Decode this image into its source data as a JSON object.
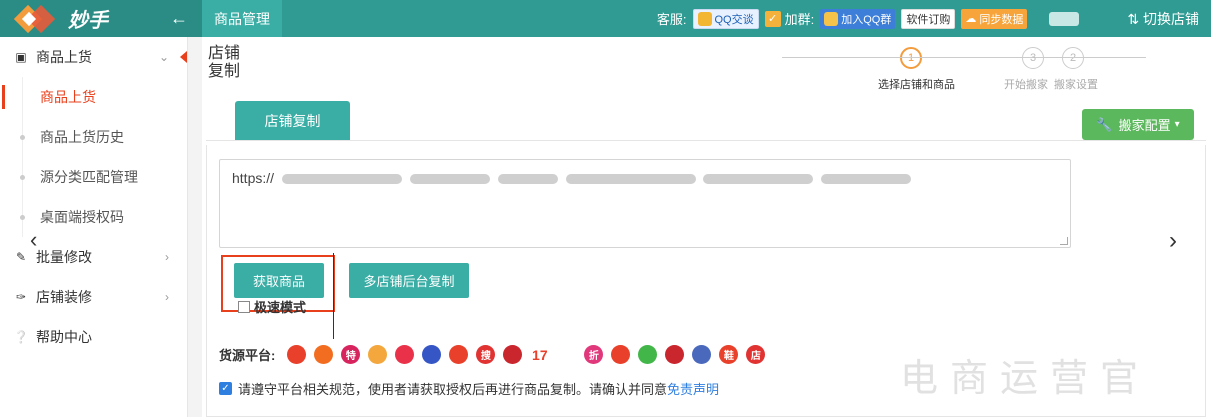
{
  "brand": {
    "name": "妙手"
  },
  "top": {
    "title": "商品管理",
    "service_label": "客服:",
    "qq_chat": "QQ交谈",
    "join_group_label": "加群:",
    "join_qq_group": "加入QQ群",
    "software_order": "软件订购",
    "sync_data": "同步数据",
    "switch_shop": "切换店铺"
  },
  "sidebar": {
    "items": [
      {
        "label": "商品上货",
        "icon": "upload-icon"
      },
      {
        "label": "批量修改",
        "icon": "edit-icon"
      },
      {
        "label": "店铺装修",
        "icon": "brush-icon"
      },
      {
        "label": "帮助中心",
        "icon": "help-icon"
      }
    ],
    "sub_items": [
      {
        "label": "商品上货"
      },
      {
        "label": "商品上货历史"
      },
      {
        "label": "源分类匹配管理"
      },
      {
        "label": "桌面端授权码"
      }
    ]
  },
  "main": {
    "page_title": "店铺复制",
    "steps": [
      {
        "num": "1",
        "label": "选择店铺和商品"
      },
      {
        "num": "2",
        "label": "搬家设置"
      },
      {
        "num": "3",
        "label": "开始搬家"
      }
    ],
    "tab_label": "店铺复制",
    "config_button": "搬家配置",
    "url_value": "https://",
    "get_button": "获取商品",
    "fast_mode": "极速模式",
    "multi_button": "多店铺后台复制",
    "platform_label": "货源平台:",
    "platforms": [
      "",
      "",
      "特",
      "",
      "",
      "",
      "",
      "搜",
      "",
      "17",
      "",
      "折",
      "",
      "",
      "",
      "",
      "鞋",
      "店"
    ],
    "agree_text": "请遵守平台相关规范，使用者请获取授权后再进行商品复制。请确认并同意",
    "agree_link": "免责声明"
  },
  "watermark": "电商运营官"
}
